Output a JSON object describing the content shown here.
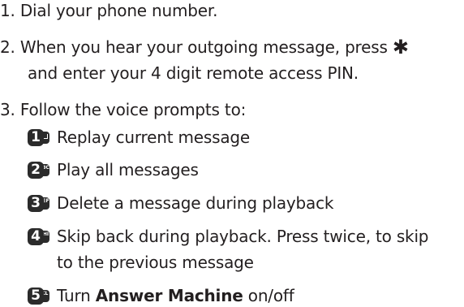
{
  "steps": [
    {
      "number": "1.",
      "text": "Dial your phone number."
    },
    {
      "number": "2.",
      "text_before": "When you hear your outgoing message, press",
      "symbol": "✱",
      "continuation": "and enter your 4 digit remote access PIN."
    },
    {
      "number": "3.",
      "text": "Follow the voice prompts to:"
    }
  ],
  "options": [
    {
      "key": "1",
      "letters": "",
      "text": "Replay current message"
    },
    {
      "key": "2",
      "letters": "ABC",
      "text": "Play all messages"
    },
    {
      "key": "3",
      "letters": "DEF",
      "text": "Delete a message during playback"
    },
    {
      "key": "4",
      "letters": "GHI",
      "text": "Skip back during playback. Press twice, to skip",
      "continuation": "to the previous message"
    },
    {
      "key": "5",
      "letters": "JKL",
      "text_bold": "Turn",
      "text_bold_part": "Answer Machine",
      "text_after": "on/off"
    }
  ]
}
